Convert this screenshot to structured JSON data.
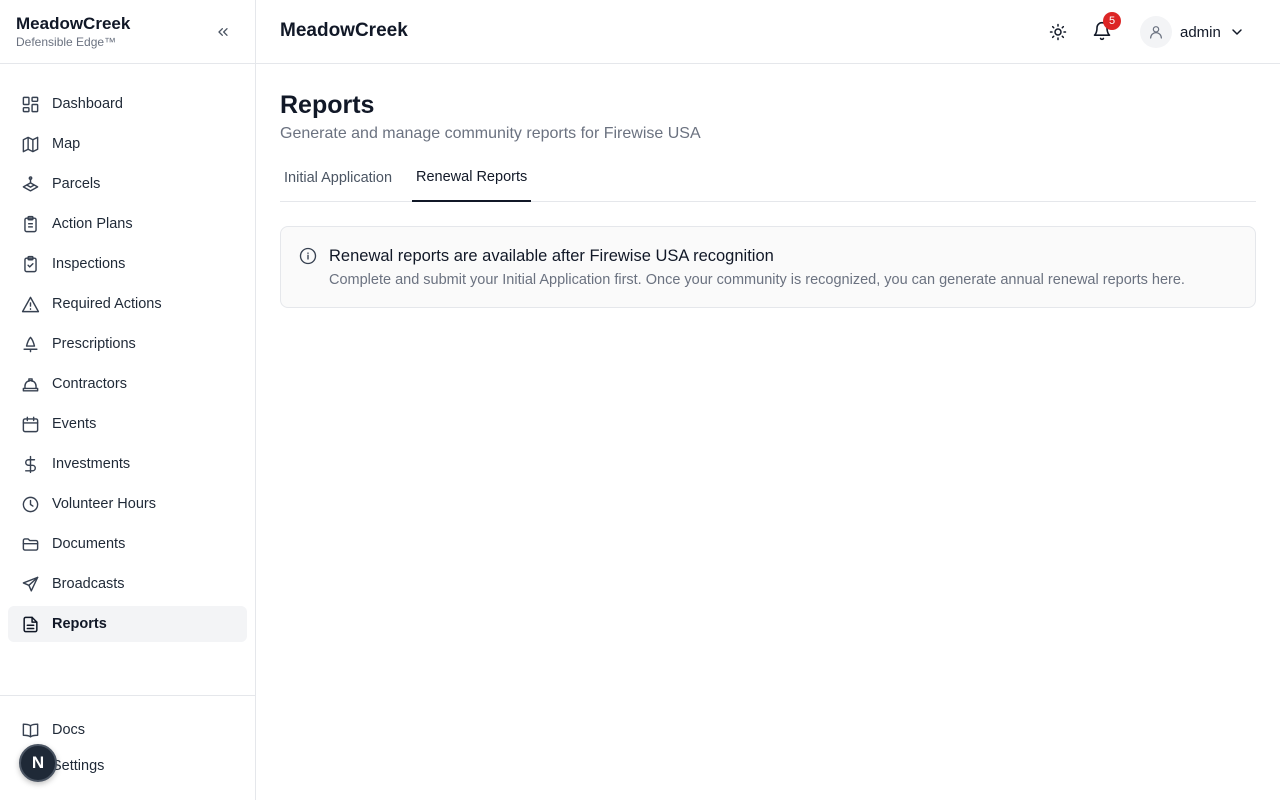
{
  "app": {
    "brand": "MeadowCreek",
    "tagline": "Defensible Edge™"
  },
  "sidebar": {
    "items": [
      {
        "label": "Dashboard",
        "icon": "dashboard-icon",
        "active": false
      },
      {
        "label": "Map",
        "icon": "map-icon",
        "active": false
      },
      {
        "label": "Parcels",
        "icon": "parcels-icon",
        "active": false
      },
      {
        "label": "Action Plans",
        "icon": "clipboard-icon",
        "active": false
      },
      {
        "label": "Inspections",
        "icon": "clipboard-check-icon",
        "active": false
      },
      {
        "label": "Required Actions",
        "icon": "warning-icon",
        "active": false
      },
      {
        "label": "Prescriptions",
        "icon": "tree-icon",
        "active": false
      },
      {
        "label": "Contractors",
        "icon": "hard-hat-icon",
        "active": false
      },
      {
        "label": "Events",
        "icon": "calendar-icon",
        "active": false
      },
      {
        "label": "Investments",
        "icon": "dollar-icon",
        "active": false
      },
      {
        "label": "Volunteer Hours",
        "icon": "clock-icon",
        "active": false
      },
      {
        "label": "Documents",
        "icon": "folder-icon",
        "active": false
      },
      {
        "label": "Broadcasts",
        "icon": "send-icon",
        "active": false
      },
      {
        "label": "Reports",
        "icon": "file-text-icon",
        "active": true
      }
    ],
    "bottom": [
      {
        "label": "Docs",
        "icon": "book-icon"
      },
      {
        "label": "Settings",
        "icon": "gear-icon"
      }
    ],
    "fab_letter": "N"
  },
  "topbar": {
    "title": "MeadowCreek",
    "notification_count": "5",
    "user": "admin"
  },
  "page": {
    "title": "Reports",
    "subtitle": "Generate and manage community reports for Firewise USA",
    "tabs": [
      {
        "label": "Initial Application",
        "active": false
      },
      {
        "label": "Renewal Reports",
        "active": true
      }
    ],
    "alert": {
      "title": "Renewal reports are available after Firewise USA recognition",
      "body": "Complete and submit your Initial Application first. Once your community is recognized, you can generate annual renewal reports here."
    }
  },
  "colors": {
    "accent": "#111827",
    "badge": "#dc2626",
    "active_bg": "#f3f4f6"
  }
}
